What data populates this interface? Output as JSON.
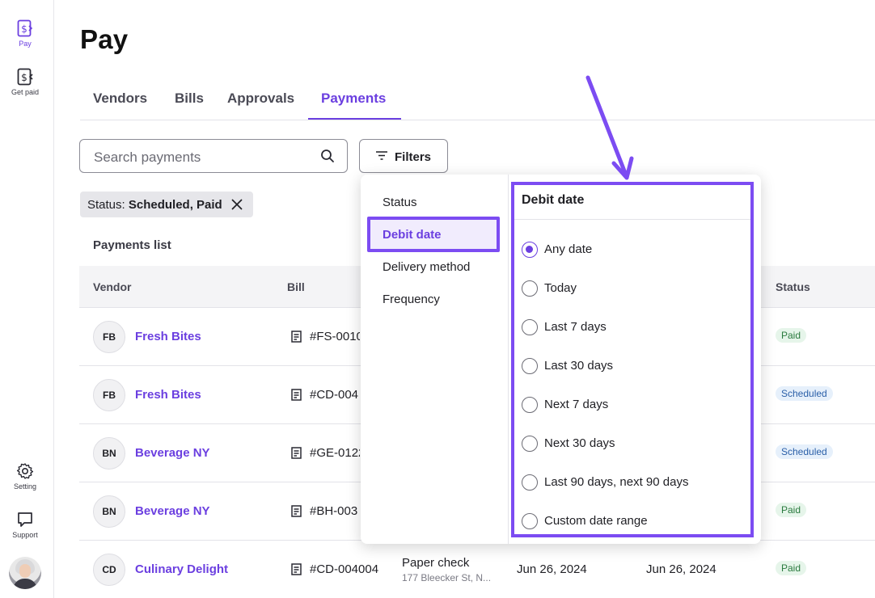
{
  "rail": {
    "pay_label": "Pay",
    "get_paid_label": "Get paid",
    "setting_label": "Setting",
    "support_label": "Support"
  },
  "page": {
    "title": "Pay"
  },
  "tabs": [
    {
      "label": "Vendors"
    },
    {
      "label": "Bills"
    },
    {
      "label": "Approvals"
    },
    {
      "label": "Payments",
      "active": true
    }
  ],
  "search": {
    "placeholder": "Search payments"
  },
  "filters_label": "Filters",
  "chip": {
    "prefix": "Status: ",
    "value": "Scheduled, Paid"
  },
  "list_title": "Payments list",
  "table": {
    "columns": {
      "vendor": "Vendor",
      "bill": "Bill",
      "status": "Status"
    },
    "rows": [
      {
        "initials": "FB",
        "vendor": "Fresh Bites",
        "bill": "#FS-0010",
        "status": "Paid"
      },
      {
        "initials": "FB",
        "vendor": "Fresh Bites",
        "bill": "#CD-004",
        "status": "Scheduled"
      },
      {
        "initials": "BN",
        "vendor": "Beverage NY",
        "bill": "#GE-0122",
        "status": "Scheduled"
      },
      {
        "initials": "BN",
        "vendor": "Beverage NY",
        "bill": "#BH-003",
        "status": "Paid"
      },
      {
        "initials": "CD",
        "vendor": "Culinary Delight",
        "bill": "#CD-004004",
        "delivery": "Paper check",
        "address": "177 Bleecker St, N...",
        "debit_date": "Jun 26, 2024",
        "delivery_date": "Jun 26, 2024",
        "status": "Paid"
      }
    ]
  },
  "dropdown": {
    "categories": [
      {
        "label": "Status"
      },
      {
        "label": "Debit date",
        "active": true
      },
      {
        "label": "Delivery method"
      },
      {
        "label": "Frequency"
      }
    ],
    "panel_title": "Debit date",
    "options": [
      {
        "label": "Any date",
        "selected": true
      },
      {
        "label": "Today"
      },
      {
        "label": "Last 7 days"
      },
      {
        "label": "Last 30 days"
      },
      {
        "label": "Next 7 days"
      },
      {
        "label": "Next 30 days"
      },
      {
        "label": "Last 90 days, next 90 days"
      },
      {
        "label": "Custom date range"
      }
    ]
  },
  "colors": {
    "accent": "#6b3fe0",
    "highlight": "#7c4cf2"
  }
}
